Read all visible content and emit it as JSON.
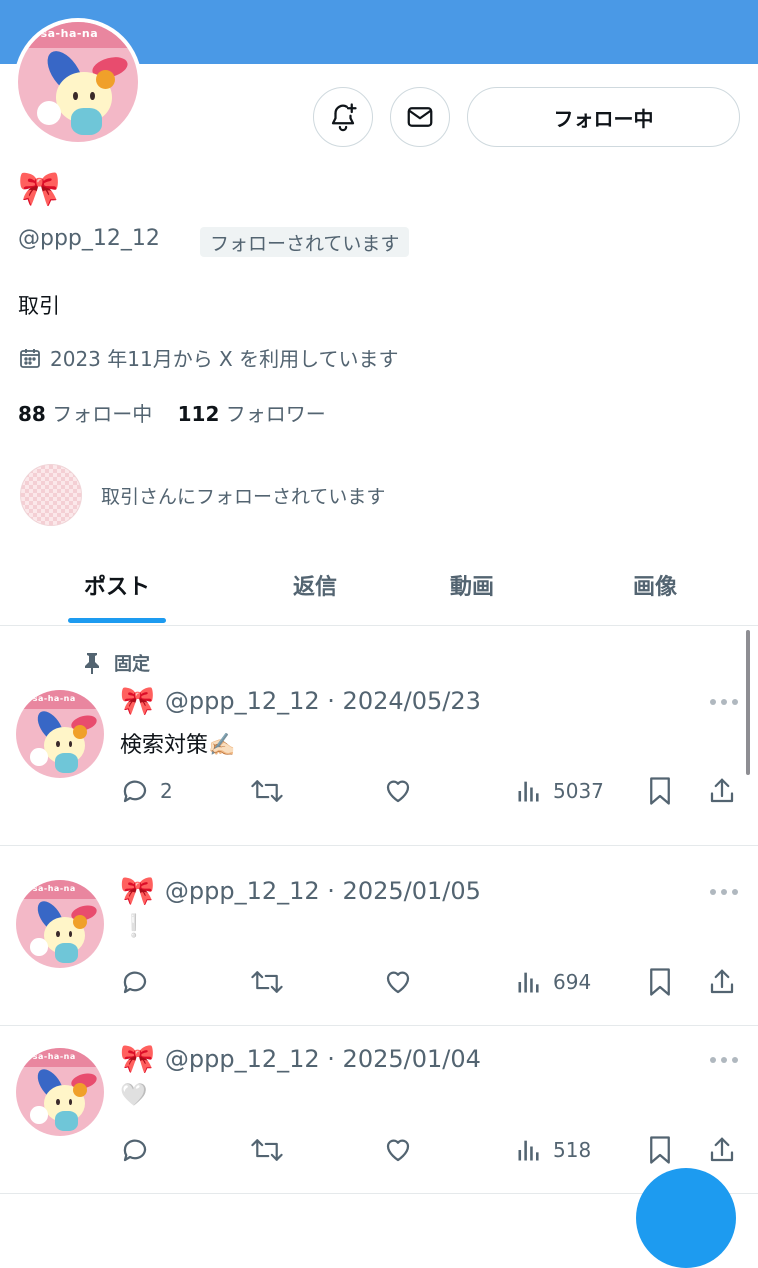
{
  "profile": {
    "avatar_banner_text": "a-sa-ha-na",
    "display_name_emoji": "🎀",
    "handle": "@ppp_12_12",
    "follows_you": "フォローされています",
    "bio": "取引",
    "joined": "2023 年11月から X を利用しています",
    "following_count": "88",
    "following_label": "フォロー中",
    "followers_count": "112",
    "followers_label": "フォロワー",
    "followed_by_text": "取引さんにフォローされています"
  },
  "header": {
    "follow_button_label": "フォロー中"
  },
  "tabs": [
    {
      "label": "ポスト"
    },
    {
      "label": "返信"
    },
    {
      "label": "動画"
    },
    {
      "label": "画像"
    }
  ],
  "pinned_label": "固定",
  "posts": [
    {
      "emoji": "🎀",
      "handle": "@ppp_12_12",
      "date": "2024/05/23",
      "text": "検索対策✍🏻",
      "replies": "2",
      "views": "5037"
    },
    {
      "emoji": "🎀",
      "handle": "@ppp_12_12",
      "date": "2025/01/05",
      "text": "❕",
      "replies": "",
      "views": "694"
    },
    {
      "emoji": "🎀",
      "handle": "@ppp_12_12",
      "date": "2025/01/04",
      "text": "🤍",
      "replies": "",
      "views": "518"
    }
  ],
  "colors": {
    "banner": "#4a99e6",
    "accent": "#1d9bf0",
    "text": "#0f1419",
    "secondary_text": "#536471"
  },
  "icons": [
    "bell-plus-icon",
    "mail-icon",
    "calendar-icon",
    "pin-icon",
    "reply-icon",
    "repost-icon",
    "like-icon",
    "views-icon",
    "bookmark-icon",
    "share-icon",
    "more-icon"
  ]
}
